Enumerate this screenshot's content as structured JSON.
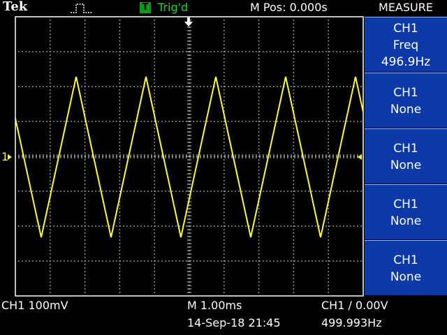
{
  "header": {
    "brand": "Tek",
    "acq_icon": "pulse-acquire-icon",
    "trigger_badge": "T",
    "trigger_status": "Trig'd",
    "position_readout": "M Pos: 0.000s"
  },
  "menu": {
    "title": "MEASURE",
    "items": [
      {
        "channel": "CH1",
        "type": "Freq",
        "value": "496.9Hz"
      },
      {
        "channel": "CH1",
        "type": "None",
        "value": ""
      },
      {
        "channel": "CH1",
        "type": "None",
        "value": ""
      },
      {
        "channel": "CH1",
        "type": "None",
        "value": ""
      },
      {
        "channel": "CH1",
        "type": "None",
        "value": ""
      }
    ]
  },
  "graticule": {
    "ch1_marker": "1",
    "trigger_marker_icon": "trigger-position-arrow-icon"
  },
  "footer": {
    "ch1_scale": "CH1  100mV",
    "timebase": "M 1.00ms",
    "datetime": "14-Sep-18 21:45",
    "trigger_setting": "CH1 ∕ 0.00V",
    "trigger_freq": "499.993Hz"
  },
  "colors": {
    "trace": "#ffff33",
    "grid": "#ffffff",
    "menu_bg": "#0b3aa8",
    "text_cyan": "#40d6ff",
    "trigger_green": "#0a9a1e"
  },
  "waveform": {
    "shape": "triangle",
    "channel": "CH1",
    "frequency_hz": 496.9
  }
}
